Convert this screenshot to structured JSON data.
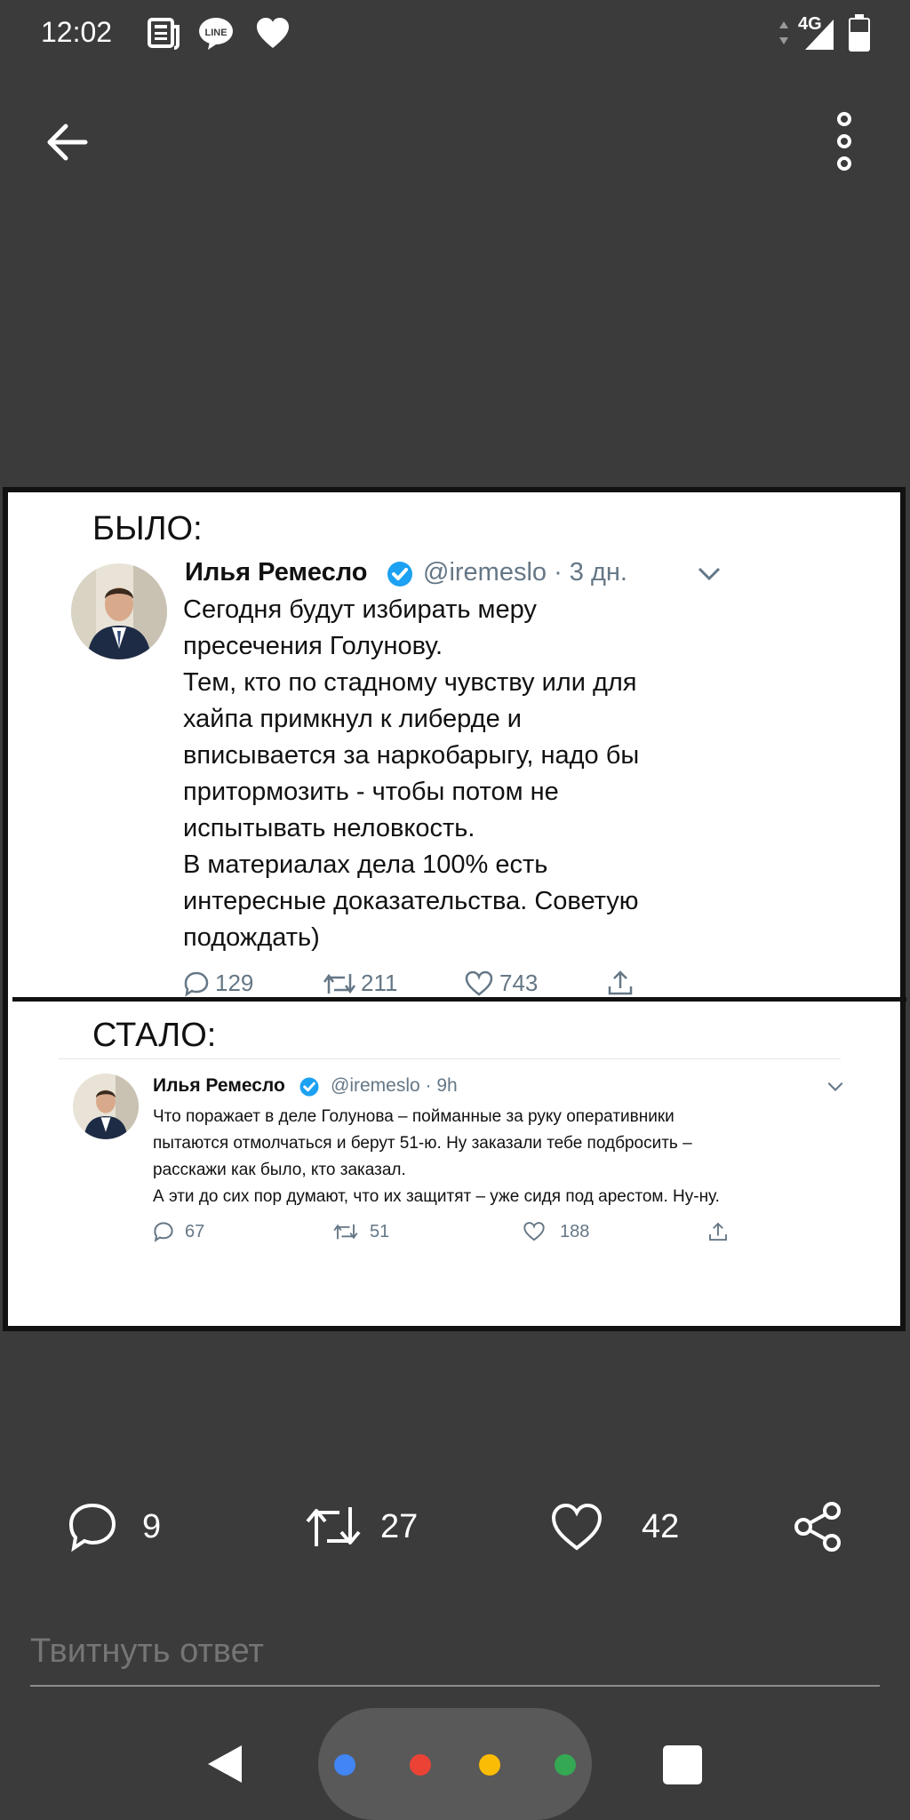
{
  "status_bar": {
    "time": "12:02",
    "network": "4G",
    "icons": [
      "news-icon",
      "line-icon",
      "heart-icon",
      "signal-icon",
      "battery-icon"
    ]
  },
  "toolbar": {
    "back_icon": "arrow-left-icon",
    "overflow_icon": "more-vertical-icon"
  },
  "image": {
    "section_before": "БЫЛО:",
    "section_after": "СТАЛО:",
    "tweet_before": {
      "name": "Илья Ремесло",
      "handle": "@iremeslo · 3 дн.",
      "text": "Сегодня будут избирать меру\nпресечения Голунову.\nТем, кто по стадному чувству или для\nхайпа примкнул к либерде и\nвписывается за наркобарыгу, надо бы\nпритормозить - чтобы потом не\nиспытывать неловкость.\nВ материалах дела 100% есть\nинтересные доказательства. Советую\nподождать)",
      "replies": "129",
      "retweets": "211",
      "likes": "743"
    },
    "tweet_after": {
      "name": "Илья Ремесло",
      "handle": "@iremeslo · 9h",
      "text": "Что поражает в деле Голунова –  пойманные за руку оперативники\nпытаются отмолчаться и берут 51-ю. Ну заказали тебе подбросить –\nрасскажи как было, кто заказал.\nА эти до сих пор думают, что их защитят – уже сидя под арестом. Ну-ну.",
      "replies": "67",
      "retweets": "51",
      "likes": "188"
    }
  },
  "actions": {
    "replies": "9",
    "retweets": "27",
    "likes": "42"
  },
  "reply_input": {
    "placeholder": "Твитнуть ответ"
  },
  "colors": {
    "background": "#3b3b3b",
    "twitter_grey": "#657786",
    "verified_blue": "#1da1f2",
    "google_blue": "#4285f4",
    "google_red": "#ea4335",
    "google_yellow": "#fbbc05",
    "google_green": "#34a853"
  }
}
